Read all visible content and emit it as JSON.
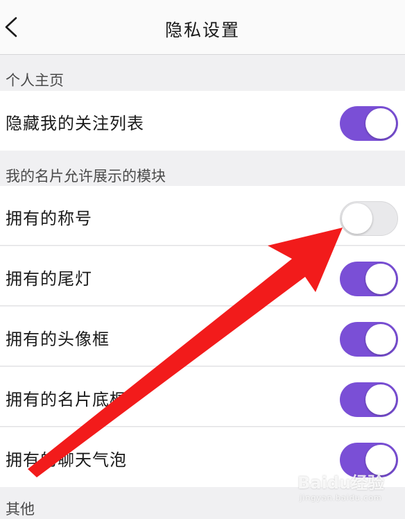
{
  "header": {
    "title": "隐私设置",
    "back_icon": "chevron-left-icon"
  },
  "sections": [
    {
      "title": "个人主页",
      "rows": [
        {
          "label": "隐藏我的关注列表",
          "on": true
        }
      ]
    },
    {
      "title": "我的名片允许展示的模块",
      "rows": [
        {
          "label": "拥有的称号",
          "on": false
        },
        {
          "label": "拥有的尾灯",
          "on": true
        },
        {
          "label": "拥有的头像框",
          "on": true
        },
        {
          "label": "拥有的名片底框",
          "on": true
        },
        {
          "label": "拥有的聊天气泡",
          "on": true
        }
      ]
    },
    {
      "title": "其他",
      "rows": []
    }
  ],
  "colors": {
    "toggle_on": "#7a4fd6",
    "toggle_off": "#e9e9eb",
    "annotation_arrow": "#f21b1b"
  },
  "watermark": {
    "text": "Baidu经验",
    "sub": "jingyan.baidu.com"
  }
}
